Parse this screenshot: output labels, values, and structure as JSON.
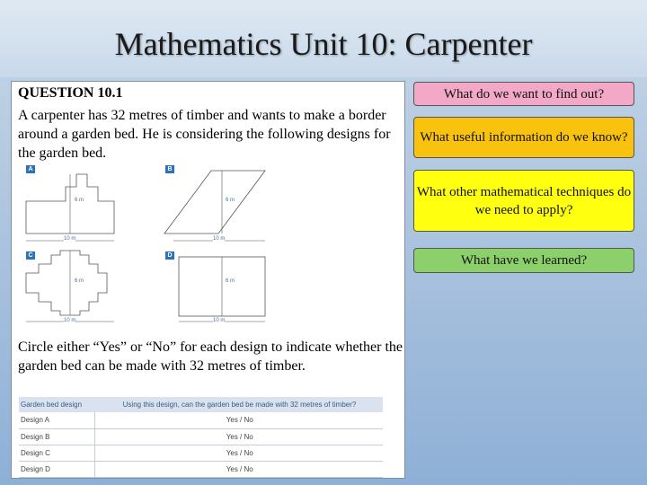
{
  "slide": {
    "title": "Mathematics Unit 10: Carpenter"
  },
  "question": {
    "heading": "QUESTION 10.1",
    "text": "A carpenter has 32 metres of timber and wants to make a border around a garden bed.  He is considering the following designs for the garden bed.",
    "instruction": "Circle either “Yes” or “No” for each design to indicate whether the garden bed can be made with 32 metres of timber."
  },
  "designs": [
    {
      "letter": "A",
      "height_label": "6 m",
      "width_label": "10 m"
    },
    {
      "letter": "B",
      "height_label": "6 m",
      "width_label": "10 m"
    },
    {
      "letter": "C",
      "height_label": "6 m",
      "width_label": "10 m"
    },
    {
      "letter": "D",
      "height_label": "6 m",
      "width_label": "10 m"
    }
  ],
  "table": {
    "headers": [
      "Garden bed design",
      "Using this design, can the garden bed be made with 32 metres of timber?"
    ],
    "rows": [
      {
        "design": "Design A",
        "answer": "Yes  /  No"
      },
      {
        "design": "Design B",
        "answer": "Yes  /  No"
      },
      {
        "design": "Design C",
        "answer": "Yes  /  No"
      },
      {
        "design": "Design D",
        "answer": "Yes  /  No"
      }
    ]
  },
  "prompts": [
    "What do we want to find out?",
    "What useful information do we know?",
    "What other mathematical techniques do we need to apply?",
    "What have we learned?"
  ],
  "colors": {
    "prompt_1": "#f2a8c6",
    "prompt_2": "#f9c20f",
    "prompt_3": "#ffff10",
    "prompt_4": "#8cd06b",
    "badge": "#2a73b8"
  }
}
